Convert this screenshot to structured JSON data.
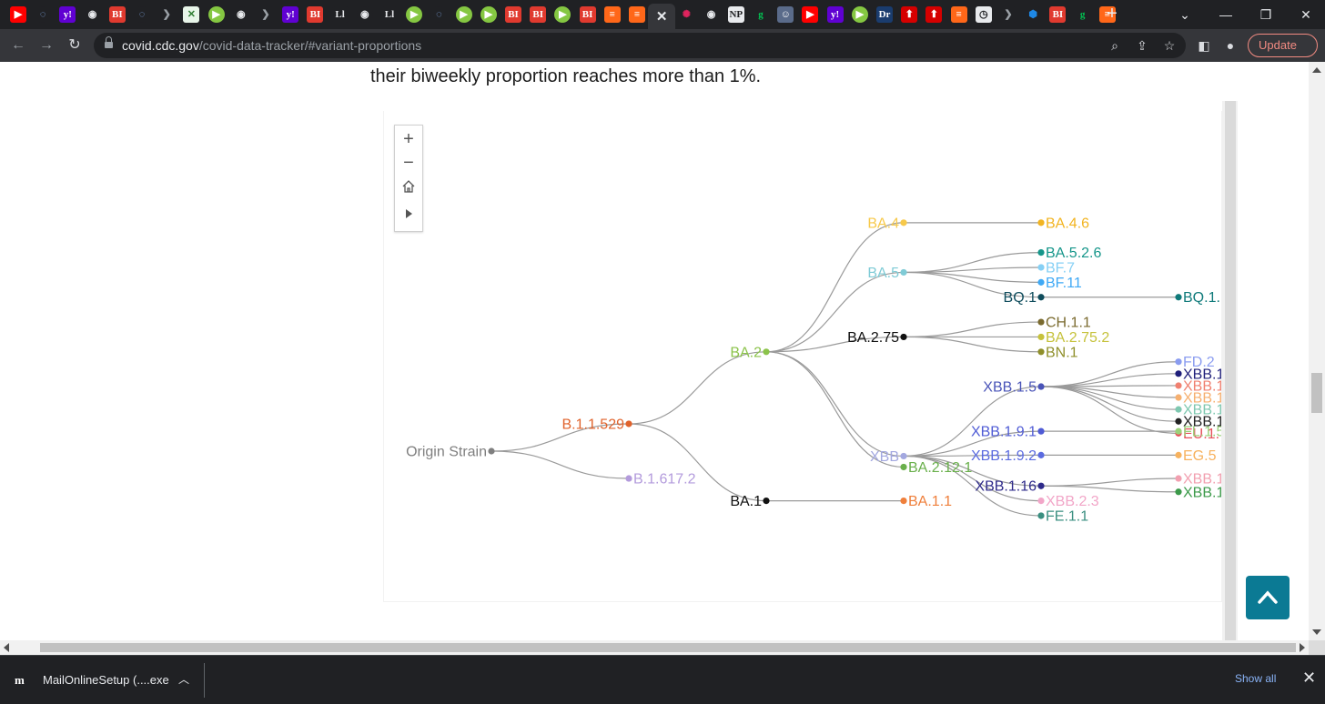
{
  "browser": {
    "tabs": [
      {
        "icon": "youtube-icon",
        "glyph": "▶",
        "bg": "#ff0000",
        "fg": "#ffffff",
        "round": false
      },
      {
        "icon": "shield-outline-icon",
        "glyph": "◌",
        "bg": "#202124",
        "fg": "#8ab4f8",
        "round": true
      },
      {
        "icon": "yahoo-icon",
        "glyph": "y!",
        "bg": "#6001d2",
        "fg": "#ffffff",
        "round": false
      },
      {
        "icon": "globe-icon",
        "glyph": "◉",
        "bg": "#202124",
        "fg": "#e8eaed",
        "round": true
      },
      {
        "icon": "business-insider-icon",
        "glyph": "BI",
        "bg": "#e03a2f",
        "fg": "#ffffff",
        "round": false
      },
      {
        "icon": "shield-outline-icon",
        "glyph": "◌",
        "bg": "#202124",
        "fg": "#8ab4f8",
        "round": true
      },
      {
        "icon": "arrow-chevron-icon",
        "glyph": "❯",
        "bg": "#202124",
        "fg": "#9aa0a6",
        "round": false
      },
      {
        "icon": "puzzle-icon",
        "glyph": "✕",
        "bg": "#e8f5e9",
        "fg": "#2e7d32",
        "round": false
      },
      {
        "icon": "rumble-icon",
        "glyph": "▶",
        "bg": "#85c742",
        "fg": "#ffffff",
        "round": true
      },
      {
        "icon": "globe-icon",
        "glyph": "◉",
        "bg": "#202124",
        "fg": "#e8eaed",
        "round": true
      },
      {
        "icon": "arrow-chevron-icon",
        "glyph": "❯",
        "bg": "#202124",
        "fg": "#9aa0a6",
        "round": false
      },
      {
        "icon": "yahoo-icon",
        "glyph": "y!",
        "bg": "#6001d2",
        "fg": "#ffffff",
        "round": false
      },
      {
        "icon": "business-insider-icon",
        "glyph": "BI",
        "bg": "#e03a2f",
        "fg": "#ffffff",
        "round": false
      },
      {
        "icon": "italic-text-icon",
        "glyph": "Ll",
        "bg": "#202124",
        "fg": "#e8eaed",
        "round": false
      },
      {
        "icon": "globe-icon",
        "glyph": "◉",
        "bg": "#202124",
        "fg": "#e8eaed",
        "round": true
      },
      {
        "icon": "italic-text-icon",
        "glyph": "Ll",
        "bg": "#202124",
        "fg": "#e8eaed",
        "round": false
      },
      {
        "icon": "rumble-icon",
        "glyph": "▶",
        "bg": "#85c742",
        "fg": "#ffffff",
        "round": true
      },
      {
        "icon": "shield-outline-icon",
        "glyph": "◌",
        "bg": "#202124",
        "fg": "#8ab4f8",
        "round": true
      },
      {
        "icon": "rumble-icon",
        "glyph": "▶",
        "bg": "#85c742",
        "fg": "#ffffff",
        "round": true
      },
      {
        "icon": "rumble-icon",
        "glyph": "▶",
        "bg": "#85c742",
        "fg": "#ffffff",
        "round": true
      },
      {
        "icon": "business-insider-icon",
        "glyph": "BI",
        "bg": "#e03a2f",
        "fg": "#ffffff",
        "round": false
      },
      {
        "icon": "business-insider-icon",
        "glyph": "BI",
        "bg": "#e03a2f",
        "fg": "#ffffff",
        "round": false
      },
      {
        "icon": "rumble-icon",
        "glyph": "▶",
        "bg": "#85c742",
        "fg": "#ffffff",
        "round": true
      },
      {
        "icon": "business-insider-icon",
        "glyph": "BI",
        "bg": "#e03a2f",
        "fg": "#ffffff",
        "round": false
      },
      {
        "icon": "substack-icon",
        "glyph": "≡",
        "bg": "#ff6719",
        "fg": "#ffffff",
        "round": false
      },
      {
        "icon": "substack-icon",
        "glyph": "≡",
        "bg": "#ff6719",
        "fg": "#ffffff",
        "round": false
      },
      {
        "icon": "close-icon",
        "glyph": "✕",
        "bg": "",
        "fg": "",
        "round": false,
        "active": true
      },
      {
        "icon": "starburst-icon",
        "glyph": "✺",
        "bg": "#202124",
        "fg": "#e0245e",
        "round": false
      },
      {
        "icon": "globe-icon",
        "glyph": "◉",
        "bg": "#202124",
        "fg": "#e8eaed",
        "round": true
      },
      {
        "icon": "newspaper-icon",
        "glyph": "NP",
        "bg": "#e8eaed",
        "fg": "#202124",
        "round": false
      },
      {
        "icon": "gettr-icon",
        "glyph": "g",
        "bg": "#202124",
        "fg": "#00c853",
        "round": false
      },
      {
        "icon": "portrait-icon",
        "glyph": "☺",
        "bg": "#5a6b8a",
        "fg": "#ffffff",
        "round": false
      },
      {
        "icon": "youtube-icon",
        "glyph": "▶",
        "bg": "#ff0000",
        "fg": "#ffffff",
        "round": false
      },
      {
        "icon": "yahoo-icon",
        "glyph": "y!",
        "bg": "#6001d2",
        "fg": "#ffffff",
        "round": false
      },
      {
        "icon": "rumble-icon",
        "glyph": "▶",
        "bg": "#85c742",
        "fg": "#ffffff",
        "round": true
      },
      {
        "icon": "dr-icon",
        "glyph": "Dr",
        "bg": "#1a3c6e",
        "fg": "#ffffff",
        "round": false
      },
      {
        "icon": "red-arrow-icon",
        "glyph": "⬆",
        "bg": "#d50000",
        "fg": "#ffffff",
        "round": false
      },
      {
        "icon": "red-arrow-icon",
        "glyph": "⬆",
        "bg": "#d50000",
        "fg": "#ffffff",
        "round": false
      },
      {
        "icon": "substack-icon",
        "glyph": "≡",
        "bg": "#ff6719",
        "fg": "#ffffff",
        "round": false
      },
      {
        "icon": "clock-icon",
        "glyph": "◷",
        "bg": "#e8eaed",
        "fg": "#202124",
        "round": false
      },
      {
        "icon": "arrow-chevron-icon",
        "glyph": "❯",
        "bg": "#202124",
        "fg": "#9aa0a6",
        "round": false
      },
      {
        "icon": "hex-icon",
        "glyph": "⬢",
        "bg": "#202124",
        "fg": "#1e88e5",
        "round": false
      },
      {
        "icon": "business-insider-icon",
        "glyph": "BI",
        "bg": "#e03a2f",
        "fg": "#ffffff",
        "round": false
      },
      {
        "icon": "gettr-icon",
        "glyph": "g",
        "bg": "#202124",
        "fg": "#00c853",
        "round": false
      },
      {
        "icon": "substack-icon",
        "glyph": "≡",
        "bg": "#ff6719",
        "fg": "#ffffff",
        "round": false
      }
    ],
    "new_tab_label": "+",
    "url_host": "covid.cdc.gov",
    "url_path": "/covid-data-tracker/#variant-proportions",
    "update_label": "Update"
  },
  "page": {
    "intro_text": "their biweekly proportion reaches more than 1%."
  },
  "chart_data": {
    "type": "tree",
    "link_color": "#9a9a9a",
    "nodes": [
      {
        "id": "origin",
        "label": "Origin Strain",
        "color": "#7f7f7f",
        "depth": 0,
        "row": 0.0,
        "label_side": "left"
      },
      {
        "id": "b11529",
        "label": "B.1.1.529",
        "color": "#e0622b",
        "depth": 1,
        "row": -0.55,
        "label_side": "left",
        "parent": "origin"
      },
      {
        "id": "b1617",
        "label": "B.1.617.2",
        "color": "#b39bdc",
        "depth": 1,
        "row": 0.55,
        "label_side": "right",
        "parent": "origin"
      },
      {
        "id": "ba2",
        "label": "BA.2",
        "color": "#8bc34a",
        "depth": 2,
        "row": -2.0,
        "label_side": "left",
        "parent": "b11529"
      },
      {
        "id": "ba1",
        "label": "BA.1",
        "color": "#111111",
        "depth": 2,
        "row": 1.0,
        "label_side": "left",
        "parent": "b11529"
      },
      {
        "id": "ba4",
        "label": "BA.4",
        "color": "#f7c94a",
        "depth": 3,
        "row": -4.6,
        "label_side": "left",
        "parent": "ba2"
      },
      {
        "id": "ba5",
        "label": "BA.5",
        "color": "#7fcbd6",
        "depth": 3,
        "row": -3.6,
        "label_side": "left",
        "parent": "ba2"
      },
      {
        "id": "ba275",
        "label": "BA.2.75",
        "color": "#111111",
        "depth": 3,
        "row": -2.3,
        "label_side": "left",
        "parent": "ba2"
      },
      {
        "id": "xbb",
        "label": "XBB",
        "color": "#a3a8e0",
        "depth": 3,
        "row": 0.1,
        "label_side": "left",
        "parent": "ba2"
      },
      {
        "id": "ba2121",
        "label": "BA.2.12.1",
        "color": "#6ab04c",
        "depth": 3,
        "row": 0.32,
        "label_side": "right",
        "parent": "ba2"
      },
      {
        "id": "ba11",
        "label": "BA.1.1",
        "color": "#ef7f3b",
        "depth": 3,
        "row": 1.0,
        "label_side": "right",
        "parent": "ba1"
      },
      {
        "id": "ba46",
        "label": "BA.4.6",
        "color": "#f2b420",
        "depth": 4,
        "row": -4.6,
        "label_side": "right",
        "parent": "ba4"
      },
      {
        "id": "ba526",
        "label": "BA.5.2.6",
        "color": "#16968a",
        "depth": 4,
        "row": -4.0,
        "label_side": "right",
        "parent": "ba5"
      },
      {
        "id": "bf7",
        "label": "BF.7",
        "color": "#86d0f5",
        "depth": 4,
        "row": -3.7,
        "label_side": "right",
        "parent": "ba5"
      },
      {
        "id": "bf11",
        "label": "BF.11",
        "color": "#3fa9f5",
        "depth": 4,
        "row": -3.4,
        "label_side": "right",
        "parent": "ba5"
      },
      {
        "id": "bq1",
        "label": "BQ.1",
        "color": "#0f4c5c",
        "depth": 4,
        "row": -3.1,
        "label_side": "left",
        "parent": "ba5"
      },
      {
        "id": "ch11",
        "label": "CH.1.1",
        "color": "#7a6a2e",
        "depth": 4,
        "row": -2.6,
        "label_side": "right",
        "parent": "ba275"
      },
      {
        "id": "ba2752",
        "label": "BA.2.75.2",
        "color": "#c6c23c",
        "depth": 4,
        "row": -2.3,
        "label_side": "right",
        "parent": "ba275"
      },
      {
        "id": "bn1",
        "label": "BN.1",
        "color": "#8f8f2a",
        "depth": 4,
        "row": -2.0,
        "label_side": "right",
        "parent": "ba275"
      },
      {
        "id": "xbb15",
        "label": "XBB.1.5",
        "color": "#4a54b8",
        "depth": 4,
        "row": -1.3,
        "label_side": "left",
        "parent": "xbb"
      },
      {
        "id": "xbb191",
        "label": "XBB.1.9.1",
        "color": "#4f5bd5",
        "depth": 4,
        "row": -0.4,
        "label_side": "left",
        "parent": "xbb"
      },
      {
        "id": "xbb192",
        "label": "XBB.1.9.2",
        "color": "#5b6be0",
        "depth": 4,
        "row": 0.08,
        "label_side": "left",
        "parent": "xbb"
      },
      {
        "id": "xbb116",
        "label": "XBB.1.16",
        "color": "#2e2a8a",
        "depth": 4,
        "row": 0.7,
        "label_side": "left",
        "parent": "xbb"
      },
      {
        "id": "xbb23",
        "label": "XBB.2.3",
        "color": "#f2a6c8",
        "depth": 4,
        "row": 1.0,
        "label_side": "right",
        "parent": "xbb"
      },
      {
        "id": "fe11",
        "label": "FE.1.1",
        "color": "#3a8f80",
        "depth": 4,
        "row": 1.3,
        "label_side": "right",
        "parent": "xbb"
      },
      {
        "id": "bq1x",
        "label": "BQ.1.",
        "color": "#0f7a7a",
        "depth": 5,
        "row": -3.1,
        "label_side": "right",
        "parent": "bq1"
      },
      {
        "id": "fd2",
        "label": "FD.2",
        "color": "#8a9cf0",
        "depth": 5,
        "row": -1.8,
        "label_side": "right",
        "parent": "xbb15"
      },
      {
        "id": "xbb15a",
        "label": "XBB.1",
        "color": "#1f1f7a",
        "depth": 5,
        "row": -1.56,
        "label_side": "right",
        "parent": "xbb15"
      },
      {
        "id": "xbb15b",
        "label": "XBB.1",
        "color": "#f08070",
        "depth": 5,
        "row": -1.32,
        "label_side": "right",
        "parent": "xbb15"
      },
      {
        "id": "xbb15c",
        "label": "XBB.1",
        "color": "#f6b070",
        "depth": 5,
        "row": -1.08,
        "label_side": "right",
        "parent": "xbb15"
      },
      {
        "id": "xbb15d",
        "label": "XBB.1",
        "color": "#7ec8b0",
        "depth": 5,
        "row": -0.84,
        "label_side": "right",
        "parent": "xbb15"
      },
      {
        "id": "xbb15e",
        "label": "XBB.1",
        "color": "#222222",
        "depth": 5,
        "row": -0.6,
        "label_side": "right",
        "parent": "xbb15"
      },
      {
        "id": "eu1",
        "label": "EU.1.",
        "color": "#e8505b",
        "depth": 5,
        "row": -0.36,
        "label_side": "right",
        "parent": "xbb15"
      },
      {
        "id": "fl15",
        "label": "FL.1.5",
        "color": "#9bd17a",
        "depth": 5,
        "row": -0.4,
        "label_side": "right",
        "parent": "xbb191"
      },
      {
        "id": "eg5",
        "label": "EG.5",
        "color": "#f7b25e",
        "depth": 5,
        "row": 0.08,
        "label_side": "right",
        "parent": "xbb192"
      },
      {
        "id": "xbb116a",
        "label": "XBB.1",
        "color": "#f2a0b0",
        "depth": 5,
        "row": 0.55,
        "label_side": "right",
        "parent": "xbb116"
      },
      {
        "id": "xbb116b",
        "label": "XBB.1",
        "color": "#3c9a4a",
        "depth": 5,
        "row": 0.82,
        "label_side": "right",
        "parent": "xbb116"
      }
    ]
  },
  "controls": {
    "zoom_in": "+",
    "zoom_out": "−",
    "home_icon": "home-icon",
    "play_icon": "play-icon"
  },
  "downloads": {
    "file_name": "MailOnlineSetup (....exe",
    "show_all_label": "Show all"
  }
}
